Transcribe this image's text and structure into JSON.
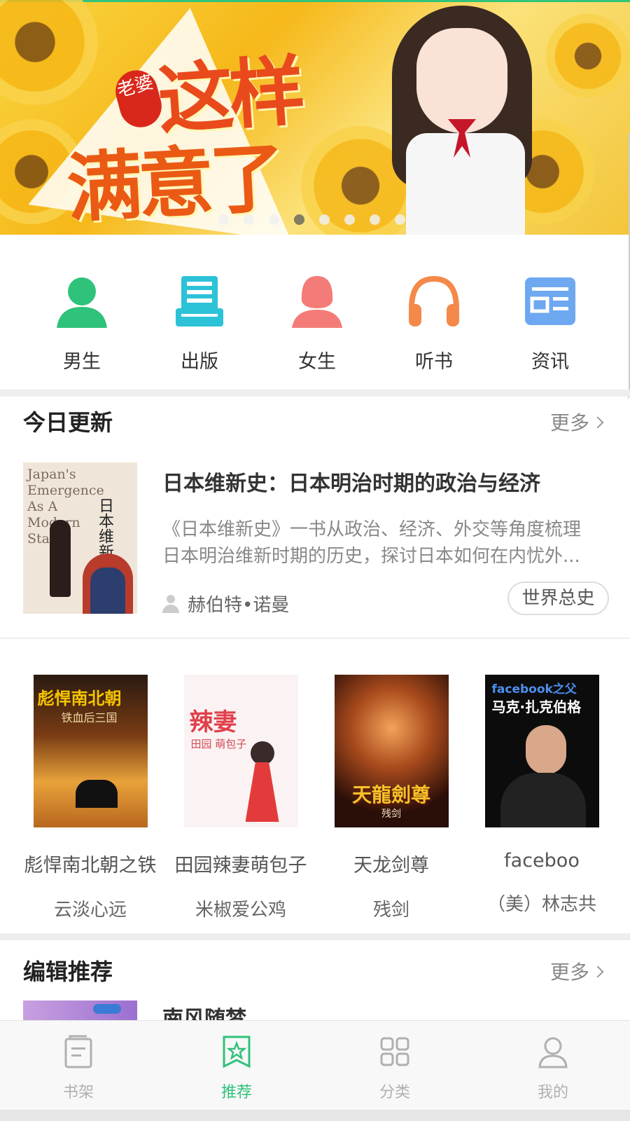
{
  "banner": {
    "badge": "老婆",
    "title_line1": "这样",
    "title_line2": "满意了",
    "dots_total": 8,
    "active_dot": 4
  },
  "categories": [
    {
      "label": "男生",
      "icon": "male-user-icon",
      "color": "#2fc27a"
    },
    {
      "label": "出版",
      "icon": "book-publish-icon",
      "color": "#2cc2d8"
    },
    {
      "label": "女生",
      "icon": "female-user-icon",
      "color": "#f47c78"
    },
    {
      "label": "听书",
      "icon": "headphones-icon",
      "color": "#f4894a"
    },
    {
      "label": "资讯",
      "icon": "news-icon",
      "color": "#6ea8f0"
    }
  ],
  "today": {
    "title": "今日更新",
    "more": "更多",
    "featured": {
      "cover_en": "Japan's Emergence As A Modern State",
      "cover_cn": "日本维新史",
      "title": "日本维新史：日本明治时期的政治与经济",
      "desc_line1": "《日本维新史》一书从政治、经济、外交等角度梳理",
      "desc_line2": "日本明治维新时期的历史，探讨日本如何在内忧外...",
      "author": "赫伯特•诺曼",
      "tag": "世界总史"
    },
    "books": [
      {
        "title": "彪悍南北朝之铁",
        "author": "云淡心远",
        "cover_text": "彪悍南北朝",
        "cover_sub": "铁血后三国"
      },
      {
        "title": "田园辣妻萌包子",
        "author": "米椒爱公鸡",
        "cover_text": "辣妻",
        "cover_sub": "田园 萌包子"
      },
      {
        "title": "天龙剑尊",
        "author": "残剑",
        "cover_text": "天龍劍尊",
        "cover_sub": "残剑"
      },
      {
        "title": "faceboo",
        "author": "（美）林志共",
        "cover_text": "facebook之父",
        "cover_sub": "马克·扎克伯格"
      }
    ]
  },
  "editor": {
    "title": "编辑推荐",
    "more": "更多",
    "first_book_title": "南风随梦"
  },
  "tabs": [
    {
      "label": "书架",
      "icon": "bookshelf-icon",
      "active": false
    },
    {
      "label": "推荐",
      "icon": "recommend-star-icon",
      "active": true
    },
    {
      "label": "分类",
      "icon": "category-grid-icon",
      "active": false
    },
    {
      "label": "我的",
      "icon": "profile-icon",
      "active": false
    }
  ],
  "colors": {
    "accent": "#2fc27a",
    "separator": "#eeeeee"
  }
}
